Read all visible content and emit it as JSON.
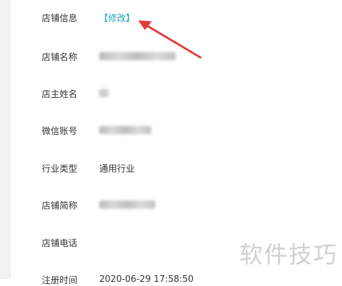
{
  "fields": [
    {
      "label": "店铺信息",
      "value": ""
    },
    {
      "label": "店铺名称",
      "value": ""
    },
    {
      "label": "店主姓名",
      "value": ""
    },
    {
      "label": "微信账号",
      "value": ""
    },
    {
      "label": "行业类型",
      "value": "通用行业"
    },
    {
      "label": "店铺简称",
      "value": ""
    },
    {
      "label": "店铺电话",
      "value": ""
    },
    {
      "label": "注册时间",
      "value": "2020-06-29 17:58:50"
    }
  ],
  "edit_link": "【修改】",
  "watermark": "软件技巧",
  "colors": {
    "accent": "#1aa5b5",
    "arrow": "#e53935",
    "text": "#333333"
  }
}
